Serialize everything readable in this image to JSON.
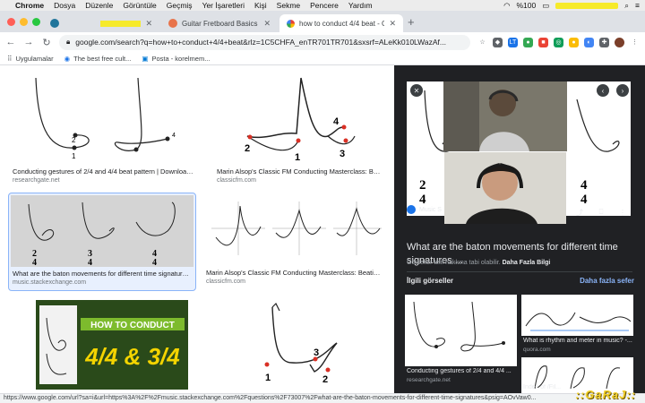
{
  "menubar": {
    "apple": "",
    "items": [
      "Chrome",
      "Dosya",
      "Düzenle",
      "Görüntüle",
      "Geçmiş",
      "Yer İşaretleri",
      "Kişi",
      "Sekme",
      "Pencere",
      "Yardım"
    ],
    "battery": "%100"
  },
  "tabs": [
    {
      "title": "",
      "active": false
    },
    {
      "title": "Guitar Fretboard Basics - How",
      "active": false
    },
    {
      "title": "how to conduct 4/4 beat - Goo",
      "active": true
    }
  ],
  "address": {
    "url": "google.com/search?q=how+to+conduct+4/4+beat&rlz=1C5CHFA_enTR701TR701&sxsrf=ALeKk010LWazAf..."
  },
  "bookmarks": [
    {
      "label": "Uygulamalar",
      "icon": "apps-grid-icon"
    },
    {
      "label": "The best free cult...",
      "icon": "bookmark-icon"
    },
    {
      "label": "Posta - korelmem...",
      "icon": "mail-icon"
    }
  ],
  "results": [
    {
      "caption": "Conducting gestures of 2/4 and 4/4 beat pattern | Download ...",
      "source": "researchgate.net"
    },
    {
      "caption": "Marin Alsop's Classic FM Conducting Masterclass: Beating ti...",
      "source": "classicfm.com"
    },
    {
      "caption": "What are the baton movements for different time signatures ...",
      "source": "music.stackexchange.com"
    },
    {
      "caption": "Marin Alsop's Classic FM Conducting Masterclass: Beating ti...",
      "source": "classicfm.com"
    }
  ],
  "thumb_text": {
    "beat1": "1",
    "beat2": "2",
    "beat3": "3",
    "beat4": "4",
    "ts24_top": "2",
    "ts24_bot": "4",
    "ts34_top": "3",
    "ts34_bot": "4",
    "ts44_top": "4",
    "ts44_bot": "4",
    "howto_line1": "HOW TO CONDUCT",
    "howto_line2": "4/4 & 3/4"
  },
  "panel": {
    "source_label": "Music S",
    "title": "What are the baton movements for different time signatures ...",
    "copyright": "Görseller telif hakkına tabi olabilir.",
    "more_info": "Daha Fazla Bilgi",
    "related_header": "İlgili görseller",
    "see_more": "Daha fazla sefer",
    "related": [
      {
        "caption": "Conducting gestures of 2/4 and 4/4 ...",
        "source": "researchgate.net"
      },
      {
        "caption": "What is rhythm and meter in music? -...",
        "source": "quora.com"
      },
      {
        "caption": "Index of /Fil...",
        "source": ""
      }
    ]
  },
  "statusbar": {
    "url": "https://www.google.com/url?sa=i&url=https%3A%2F%2Fmusic.stackexchange.com%2Fquestions%2F73007%2Fwhat-are-the-baton-movements-for-different-time-signatures&psig=AOvVaw0..."
  },
  "watermark": "::GaRaJ::",
  "colors": {
    "accent": "#1a73e8",
    "panel_bg": "#202124",
    "link": "#8ab4f8",
    "beat_red": "#d93025"
  }
}
